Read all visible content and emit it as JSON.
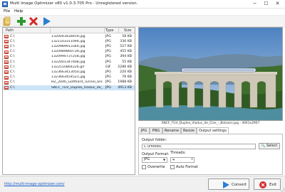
{
  "window": {
    "title": "Multi Image Optimizer v80 v1.0.3.705 Pro  -  Unregistered version.",
    "controls": {
      "minimize": "−",
      "maximize": "☐",
      "close": "✕"
    }
  },
  "menu": {
    "items": [
      "File",
      "Help"
    ]
  },
  "toolbar": {
    "buttons": [
      {
        "icon": "open-folder-icon",
        "color": "#e4b13a"
      },
      {
        "icon": "add-icon",
        "color": "#2d9a2d"
      },
      {
        "icon": "remove-icon",
        "color": "#d42a2a"
      },
      {
        "icon": "play-icon",
        "color": "#2a7fd1"
      }
    ]
  },
  "file_list": {
    "columns": {
      "path": "Path",
      "name": "",
      "type": "Type",
      "size": "Size"
    },
    "rows": [
      {
        "path": "C:\\",
        "name": "1320043428459.jpg",
        "type": "JPG",
        "size": "58 KB",
        "selected": false
      },
      {
        "path": "C:\\",
        "name": "1321103311094.jpg",
        "type": "JPG",
        "size": "336 KB",
        "selected": false
      },
      {
        "path": "C:\\",
        "name": "1320989913344.jpg",
        "type": "JPG",
        "size": "527 KB",
        "selected": false
      },
      {
        "path": "C:\\",
        "name": "1320989860739.jpg",
        "type": "JPG",
        "size": "455 KB",
        "selected": false
      },
      {
        "path": "C:\\",
        "name": "1320990737258.jpg",
        "type": "JPG",
        "size": "394 KB",
        "selected": false
      },
      {
        "path": "C:\\",
        "name": "1322001347608.jpg",
        "type": "JPG",
        "size": "55 KB",
        "selected": false
      },
      {
        "path": "C:\\",
        "name": "1322510864226.gif",
        "type": "GIF",
        "size": "2286 KB",
        "selected": false
      },
      {
        "path": "C:\\",
        "name": "1323663413050.jpg",
        "type": "JPG",
        "size": "220 KB",
        "selected": false
      },
      {
        "path": "C:\\",
        "name": "1323663454521.jpg",
        "type": "JPG",
        "size": "76 KB",
        "selected": false
      },
      {
        "path": "C:\\",
        "name": "HZ_2046_Gotthard_Tunnel_and_...",
        "type": "JPG",
        "size": "1988 KB",
        "selected": false
      },
      {
        "path": "C:\\",
        "name": "SNCF_TGV_Duplex_Viaduc_de_...",
        "type": "JPG",
        "size": "4913 KB",
        "selected": true
      }
    ]
  },
  "preview": {
    "caption": "SNCF_TGV_Duplex_Viaduc_de_Cize_-_Bolozon.jpg - 4061x2907"
  },
  "tabs": {
    "items": [
      "JPG",
      "PNG",
      "Rename",
      "Resize",
      "Output settings"
    ],
    "active": "Output settings"
  },
  "output_settings": {
    "folder_label": "Output folder:",
    "folder_value": "C:\\Photos\\",
    "select_label": "Select",
    "format_label": "Output Format:",
    "format_value": "JPG",
    "threads_label": "Threads:",
    "threads_value": "4",
    "overwrite_label": "Overwrite",
    "auto_format_label": "Auto Format"
  },
  "status": {
    "link": "http://multi-image-optimizer.com/",
    "convert_label": "Convert",
    "exit_label": "Exit"
  }
}
